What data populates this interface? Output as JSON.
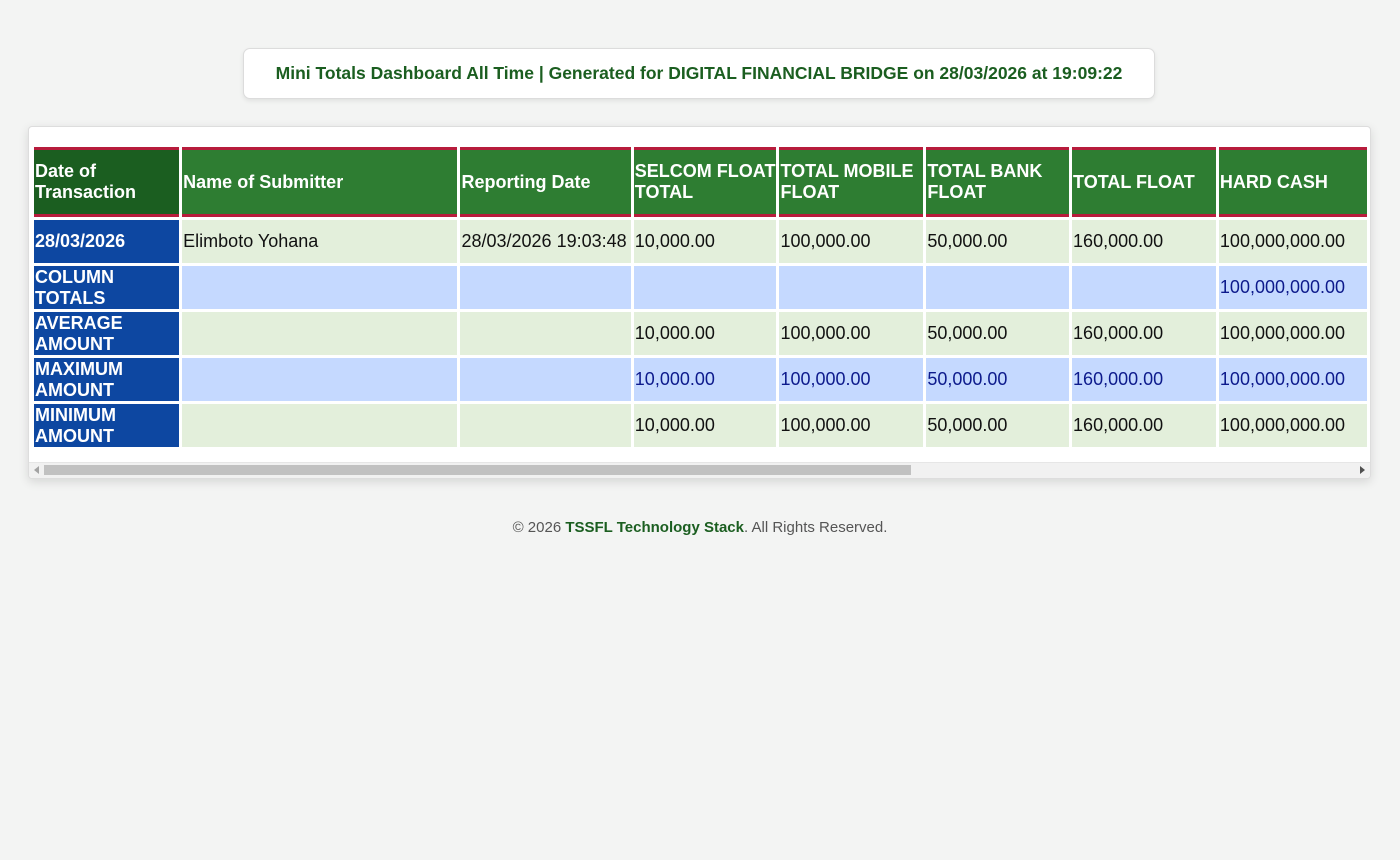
{
  "header": {
    "title": "Mini Totals Dashboard All Time | Generated for DIGITAL FINANCIAL BRIDGE on 28/03/2026 at 19:09:22"
  },
  "table": {
    "columns": [
      "Date of Transaction",
      "Name of Submitter",
      "Reporting Date",
      "SELCOM FLOAT TOTAL",
      "TOTAL MOBILE FLOAT",
      "TOTAL BANK FLOAT",
      "TOTAL FLOAT",
      "HARD CASH"
    ],
    "rows": [
      {
        "label": "28/03/2026",
        "cells": [
          "Elimboto Yohana",
          "28/03/2026 19:03:48",
          "10,000.00",
          "100,000.00",
          "50,000.00",
          "160,000.00",
          "100,000,000.00"
        ]
      },
      {
        "label": "COLUMN TOTALS",
        "cells": [
          "",
          "",
          "",
          "",
          "",
          "",
          "100,000,000.00"
        ]
      },
      {
        "label": "AVERAGE AMOUNT",
        "cells": [
          "",
          "",
          "10,000.00",
          "100,000.00",
          "50,000.00",
          "160,000.00",
          "100,000,000.00"
        ]
      },
      {
        "label": "MAXIMUM AMOUNT",
        "cells": [
          "",
          "",
          "10,000.00",
          "100,000.00",
          "50,000.00",
          "160,000.00",
          "100,000,000.00"
        ]
      },
      {
        "label": "MINIMUM AMOUNT",
        "cells": [
          "",
          "",
          "10,000.00",
          "100,000.00",
          "50,000.00",
          "160,000.00",
          "100,000,000.00"
        ]
      }
    ]
  },
  "footer": {
    "prefix": "© 2026 ",
    "brand": "TSSFL Technology Stack",
    "suffix": ". All Rights Reserved."
  },
  "colors": {
    "header_green": "#2e7d32",
    "header_dark_green": "#1b5e20",
    "label_blue": "#0d47a1",
    "row_green": "#e3efdb",
    "row_blue": "#c5d9ff",
    "accent_red": "#b71c3c"
  }
}
